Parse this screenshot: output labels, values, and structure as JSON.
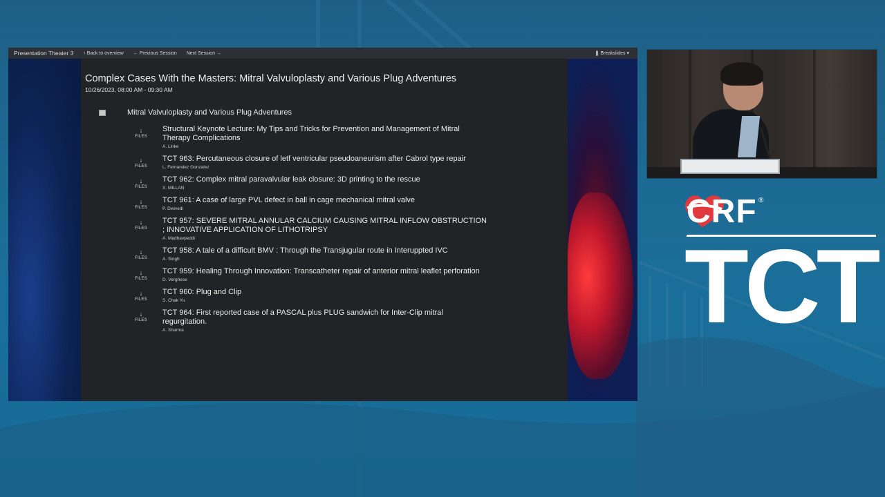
{
  "topbar": {
    "venue": "Presentation Theater 3",
    "back": "↑ Back to overview",
    "previous": "← Previous Session",
    "next": "Next Session →",
    "breakslides": "❚ Breakslides ▾"
  },
  "session": {
    "title": "Complex Cases With the Masters: Mitral Valvuloplasty and Various Plug Adventures",
    "date": "10/26/2023, 08:00 AM - 09:30 AM"
  },
  "section": {
    "title": "Mitral Valvuloplasty and Various Plug Adventures",
    "icon": "list-icon"
  },
  "files_label": "FILES",
  "files_arrow": "↓",
  "talks": [
    {
      "title": "Structural Keynote Lecture: My Tips and Tricks for Prevention and Management of Mitral Therapy Complications",
      "author": "A. Linke"
    },
    {
      "title": "TCT 963: Percutaneous closure of letf ventricular pseudoaneurism after Cabrol type repair",
      "author": "L. Fernandez Gonzalez"
    },
    {
      "title": "TCT 962: Complex mitral paravalvular leak closure: 3D printing to the rescue",
      "author": "X. MILLAN"
    },
    {
      "title": "TCT 961: A case of large PVL defect in ball in cage mechanical mitral valve",
      "author": "P. Dwivedi"
    },
    {
      "title": "TCT 957: SEVERE MITRAL ANNULAR CALCIUM CAUSING MITRAL INFLOW OBSTRUCTION ; INNOVATIVE APPLICATION OF LITHOTRIPSY",
      "author": "A. Madhavpeddi"
    },
    {
      "title": "TCT 958: A tale of a difficult BMV : Through the Transjugular route in Interuppted IVC",
      "author": "A. Singh"
    },
    {
      "title": "TCT 959: Healing Through Innovation: Transcatheter repair of anterior mitral leaflet perforation",
      "author": "D. Verghese"
    },
    {
      "title": "TCT 960: Plug and Clip",
      "author": "S. Chak Yu"
    },
    {
      "title": "TCT 964: First reported case of a PASCAL plus PLUG sandwich for Inter-Clip mitral regurgitation.",
      "author": "A. Sharma"
    }
  ],
  "branding": {
    "crf": "CRF",
    "reg": "®",
    "tct": "TCT",
    "heart_color": "#e0393e"
  }
}
